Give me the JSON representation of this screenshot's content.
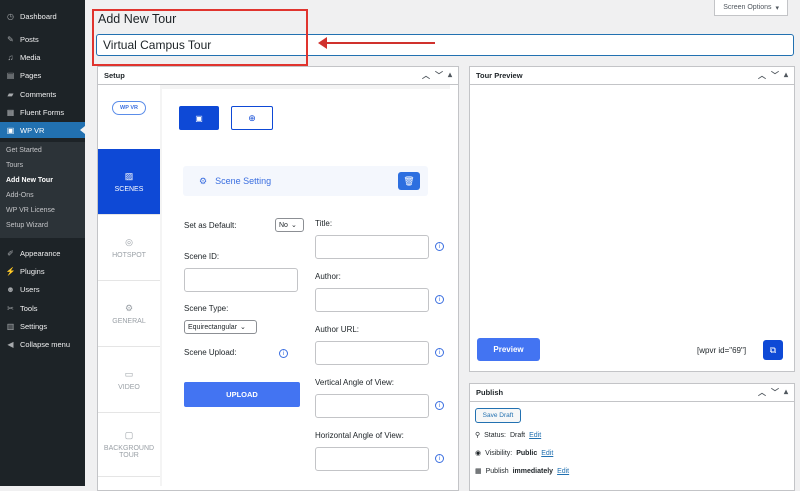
{
  "sidebar": {
    "items": [
      {
        "label": "Dashboard",
        "icon": "dashboard-icon"
      },
      {
        "label": "Posts",
        "icon": "pin-icon"
      },
      {
        "label": "Media",
        "icon": "media-icon"
      },
      {
        "label": "Pages",
        "icon": "pages-icon"
      },
      {
        "label": "Comments",
        "icon": "comment-icon"
      },
      {
        "label": "Fluent Forms",
        "icon": "form-icon"
      },
      {
        "label": "WP VR",
        "icon": "vr-icon"
      }
    ],
    "submenu": [
      "Get Started",
      "Tours",
      "Add New Tour",
      "Add-Ons",
      "WP VR License",
      "Setup Wizard"
    ],
    "lower": [
      {
        "label": "Appearance",
        "icon": "brush-icon"
      },
      {
        "label": "Plugins",
        "icon": "plugin-icon"
      },
      {
        "label": "Users",
        "icon": "users-icon"
      },
      {
        "label": "Tools",
        "icon": "wrench-icon"
      },
      {
        "label": "Settings",
        "icon": "settings-icon"
      },
      {
        "label": "Collapse menu",
        "icon": "collapse-icon"
      }
    ]
  },
  "header": {
    "screen_options": "Screen Options",
    "page_title": "Add New Tour",
    "tour_title_value": "Virtual Campus Tour"
  },
  "setup": {
    "title": "Setup",
    "logo": "WP VR",
    "tabs": [
      "SCENES",
      "HOTSPOT",
      "GENERAL",
      "VIDEO",
      "BACKGROUND TOUR"
    ],
    "scene_setting": "Scene Setting",
    "set_as_default": "Set as Default:",
    "default_value": "No",
    "scene_id": "Scene ID:",
    "scene_type": "Scene Type:",
    "scene_type_value": "Equirectangular",
    "scene_upload": "Scene Upload:",
    "upload_button": "UPLOAD",
    "right_labels": [
      "Title:",
      "Author:",
      "Author URL:",
      "Vertical Angle of View:",
      "Horizontal Angle of View:"
    ]
  },
  "preview": {
    "title": "Tour Preview",
    "button": "Preview",
    "shortcode": "[wpvr id=\"69\"]"
  },
  "publish": {
    "title": "Publish",
    "save_draft": "Save Draft",
    "status_label": "Status:",
    "status_value": "Draft",
    "visibility_label": "Visibility:",
    "visibility_value": "Public",
    "publish_label": "Publish",
    "publish_value": "immediately",
    "edit": "Edit"
  }
}
